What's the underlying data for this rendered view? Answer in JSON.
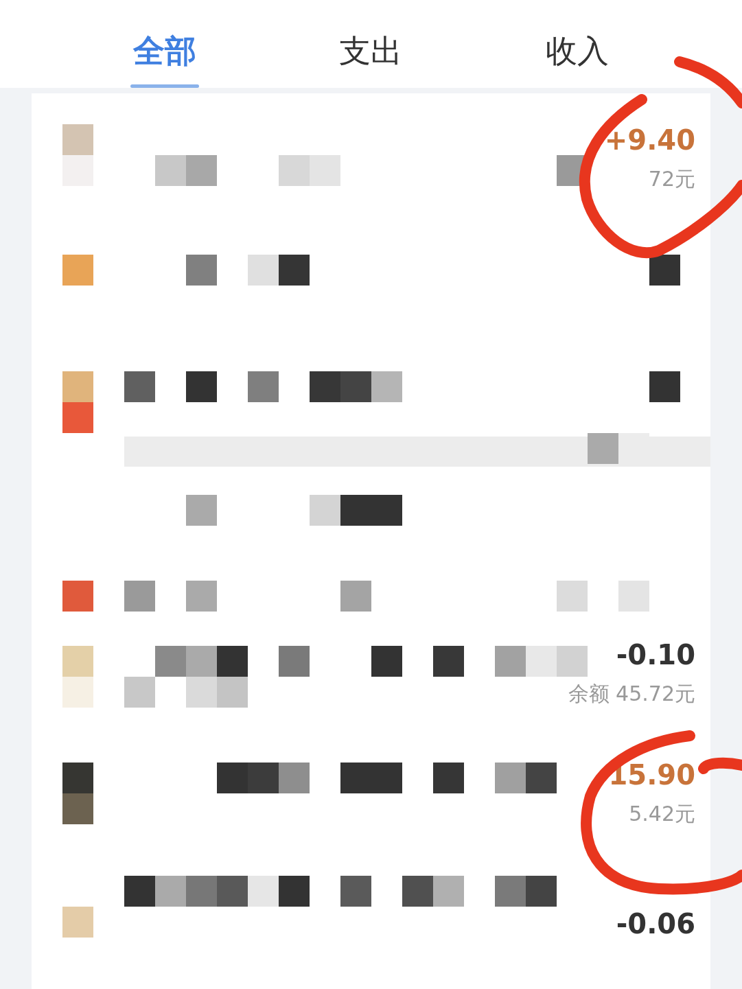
{
  "tabs": [
    {
      "label": "全部",
      "selected": true
    },
    {
      "label": "支出",
      "selected": false
    },
    {
      "label": "收入",
      "selected": false
    }
  ],
  "rows": [
    {
      "kind": "entry",
      "income": true,
      "amount": "+9.40",
      "balance": "72元"
    },
    {
      "kind": "redacted"
    },
    {
      "kind": "redacted"
    },
    {
      "kind": "redacted"
    },
    {
      "kind": "entry",
      "income": false,
      "amount": "-0.10",
      "balance": "余额 45.72元"
    },
    {
      "kind": "entry",
      "income": true,
      "amount": "15.90",
      "balance": "5.42元"
    },
    {
      "kind": "entry",
      "income": false,
      "amount": "-0.06"
    }
  ]
}
